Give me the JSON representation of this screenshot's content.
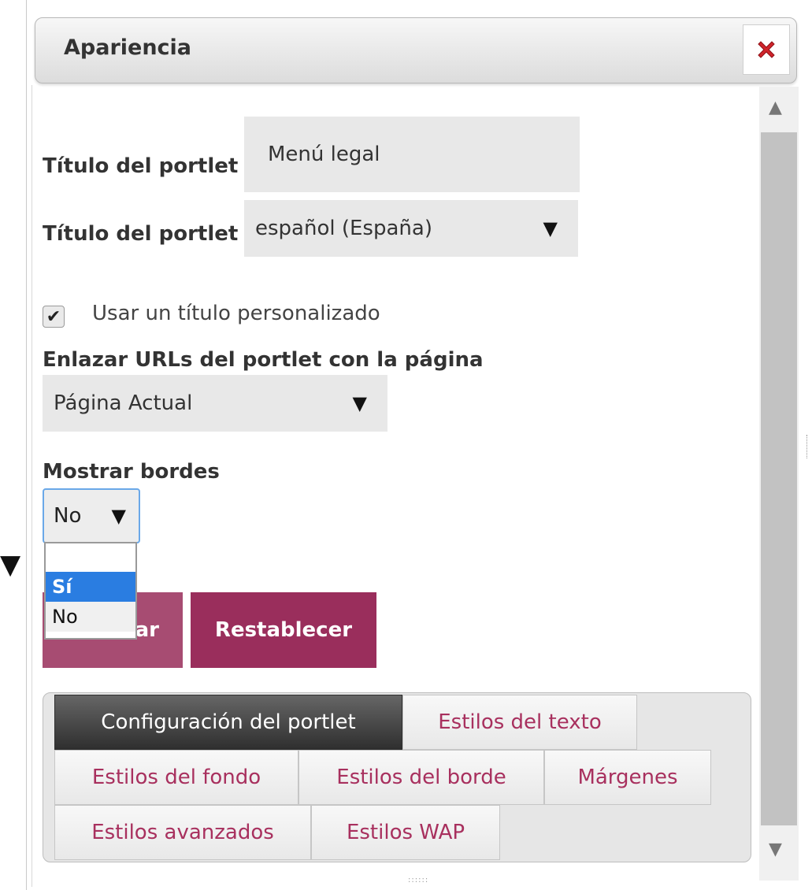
{
  "dialog": {
    "title": "Apariencia"
  },
  "form": {
    "portlet_title_label": "Título del portlet",
    "portlet_title_value": "Menú legal",
    "language_label": "Título del portlet",
    "language_value": "español (España)",
    "custom_title_checked": true,
    "custom_title_label": "Usar un título personalizado",
    "link_urls_label": "Enlazar URLs del portlet con la página",
    "link_urls_value": "Página Actual",
    "show_borders_label": "Mostrar bordes",
    "show_borders_value": "No",
    "show_borders_options": [
      "",
      "Sí",
      "No"
    ],
    "show_borders_highlighted": "Sí"
  },
  "buttons": {
    "save_label_visible": "ar",
    "reset_label": "Restablecer"
  },
  "tabs": [
    {
      "label": "Configuración del portlet",
      "active": true
    },
    {
      "label": "Estilos del texto",
      "active": false
    },
    {
      "label": "Estilos del fondo",
      "active": false
    },
    {
      "label": "Estilos del borde",
      "active": false
    },
    {
      "label": "Márgenes",
      "active": false
    },
    {
      "label": "Estilos avanzados",
      "active": false
    },
    {
      "label": "Estilos WAP",
      "active": false
    }
  ],
  "icons": {
    "close": "close-icon",
    "dropdown": "triangle-down-icon",
    "scroll_up": "triangle-up-icon",
    "scroll_down": "triangle-down-icon",
    "checkbox": "checkmark-icon"
  },
  "colors": {
    "accent": "#9a2e5c",
    "tab_text": "#a8305e",
    "active_tab": "#3a3a3a",
    "selection": "#2a7de1",
    "close": "#d0242b"
  }
}
